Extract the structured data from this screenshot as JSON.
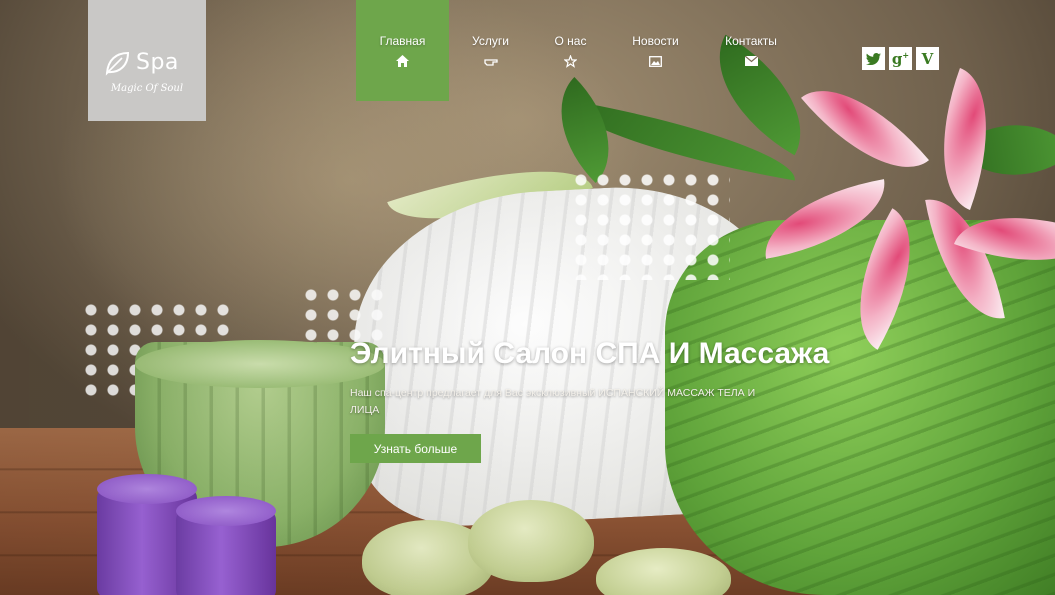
{
  "logo": {
    "title": "Spa",
    "tagline": "Magic Of Soul"
  },
  "nav": {
    "items": [
      {
        "label": "Главная",
        "icon": "home-icon",
        "active": true
      },
      {
        "label": "Услуги",
        "icon": "hand-pointer-icon",
        "active": false
      },
      {
        "label": "О нас",
        "icon": "star-icon",
        "active": false
      },
      {
        "label": "Новости",
        "icon": "image-icon",
        "active": false
      },
      {
        "label": "Контакты",
        "icon": "envelope-icon",
        "active": false
      }
    ]
  },
  "social": [
    "twitter-icon",
    "google-plus-icon",
    "vimeo-icon"
  ],
  "hero": {
    "title": "Элитный Салон СПА И Массажа",
    "description": "Наш спа-центр предлагает для Вас эксклюзивный ИСПАНСКИЙ МАССАЖ ТЕЛА И ЛИЦА",
    "button": "Узнать больше"
  },
  "colors": {
    "accent": "#6ea64b",
    "logo_bg": "#c9c8c6"
  }
}
